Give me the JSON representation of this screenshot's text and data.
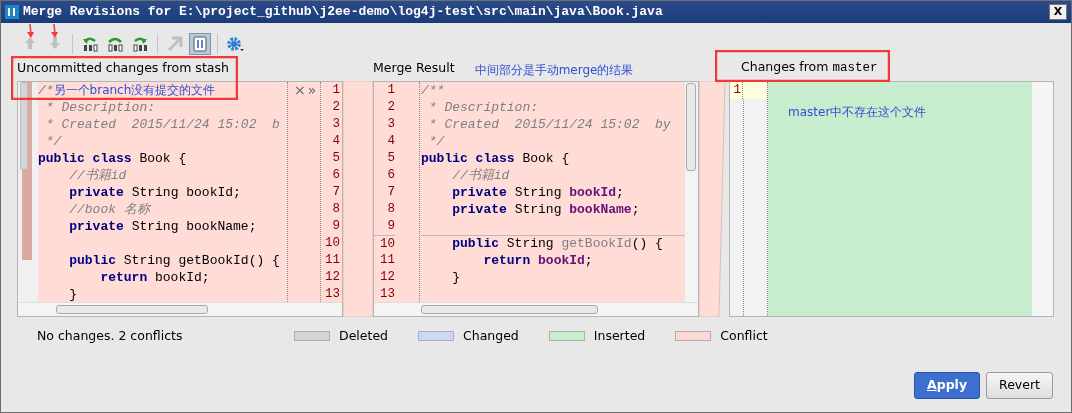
{
  "window": {
    "title": "Merge Revisions for E:\\project_github\\j2ee-demo\\log4j-test\\src\\main\\java\\Book.java",
    "close": "X"
  },
  "toolbar": [
    {
      "kind": "up",
      "disabled": true,
      "selected": false
    },
    {
      "kind": "down",
      "disabled": true,
      "selected": false
    },
    {
      "kind": "sep"
    },
    {
      "kind": "apply-left",
      "disabled": false,
      "selected": false
    },
    {
      "kind": "apply-both",
      "disabled": false,
      "selected": false
    },
    {
      "kind": "apply-right",
      "disabled": false,
      "selected": false
    },
    {
      "kind": "sep"
    },
    {
      "kind": "magic",
      "disabled": true,
      "selected": false
    },
    {
      "kind": "sync",
      "disabled": false,
      "selected": true
    },
    {
      "kind": "sep"
    },
    {
      "kind": "gear",
      "disabled": false,
      "selected": false
    }
  ],
  "left": {
    "header": "Uncommitted changes from stash",
    "actions": [
      "×",
      "»"
    ],
    "lines": [
      {
        "num": "1",
        "segs": [
          {
            "text": "/*",
            "kind": "comment"
          },
          {
            "text": "另一个branch没有提交的文件",
            "kind": "note"
          }
        ]
      },
      {
        "num": "2",
        "segs": [
          {
            "text": " * Description:",
            "kind": "comment"
          }
        ]
      },
      {
        "num": "3",
        "segs": [
          {
            "text": " * Created  2015/11/24 15:02  b",
            "kind": "comment"
          }
        ]
      },
      {
        "num": "4",
        "segs": [
          {
            "text": " */",
            "kind": "comment"
          }
        ]
      },
      {
        "num": "5",
        "segs": [
          {
            "text": "public class",
            "kind": "kw"
          },
          {
            "text": " Book {",
            "kind": "plain"
          }
        ]
      },
      {
        "num": "6",
        "segs": [
          {
            "text": "    //书籍id",
            "kind": "comment"
          }
        ]
      },
      {
        "num": "7",
        "segs": [
          {
            "text": "    private",
            "kind": "kw"
          },
          {
            "text": " String bookId;",
            "kind": "plain"
          }
        ]
      },
      {
        "num": "8",
        "segs": [
          {
            "text": "    //book 名称",
            "kind": "comment"
          }
        ]
      },
      {
        "num": "9",
        "segs": [
          {
            "text": "    private",
            "kind": "kw"
          },
          {
            "text": " String bookName;",
            "kind": "plain"
          }
        ]
      },
      {
        "num": "10"
      },
      {
        "num": "11",
        "segs": [
          {
            "text": "    public",
            "kind": "kw"
          },
          {
            "text": " String getBookId() {",
            "kind": "plain"
          }
        ]
      },
      {
        "num": "12",
        "segs": [
          {
            "text": "        return",
            "kind": "kw"
          },
          {
            "text": " bookId;",
            "kind": "plain"
          }
        ]
      },
      {
        "num": "13",
        "segs": [
          {
            "text": "    }",
            "kind": "plain"
          }
        ]
      }
    ]
  },
  "middle": {
    "header": "Merge Result",
    "note": "中间部分是手动merge的结果",
    "lines": [
      {
        "num": "1",
        "divider": false,
        "segs": [
          {
            "text": "/**",
            "kind": "comment"
          }
        ]
      },
      {
        "num": "2",
        "divider": false,
        "segs": [
          {
            "text": " * Description:",
            "kind": "comment"
          }
        ]
      },
      {
        "num": "3",
        "divider": false,
        "segs": [
          {
            "text": " * Created  2015/11/24 15:02  by",
            "kind": "comment"
          }
        ]
      },
      {
        "num": "4",
        "divider": false,
        "segs": [
          {
            "text": " */",
            "kind": "comment"
          }
        ]
      },
      {
        "num": "5",
        "divider": false,
        "segs": [
          {
            "text": "public class",
            "kind": "kw"
          },
          {
            "text": " Book {",
            "kind": "plain"
          }
        ]
      },
      {
        "num": "6",
        "divider": false,
        "segs": [
          {
            "text": "    //书籍id",
            "kind": "comment"
          }
        ]
      },
      {
        "num": "7",
        "divider": false,
        "segs": [
          {
            "text": "    private",
            "kind": "kw"
          },
          {
            "text": " String ",
            "kind": "plain"
          },
          {
            "text": "bookId",
            "kind": "field"
          },
          {
            "text": ";",
            "kind": "plain"
          }
        ]
      },
      {
        "num": "8",
        "divider": false,
        "segs": [
          {
            "text": "    private",
            "kind": "kw"
          },
          {
            "text": " String ",
            "kind": "plain"
          },
          {
            "text": "bookName",
            "kind": "field"
          },
          {
            "text": ";",
            "kind": "plain"
          }
        ]
      },
      {
        "num": "9",
        "divider": false
      },
      {
        "num": "10",
        "divider": true,
        "segs": [
          {
            "text": "    public",
            "kind": "kw"
          },
          {
            "text": " String ",
            "kind": "plain"
          },
          {
            "text": "getBookId",
            "kind": "dim"
          },
          {
            "text": "() {",
            "kind": "plain"
          }
        ]
      },
      {
        "num": "11",
        "divider": false,
        "segs": [
          {
            "text": "        return ",
            "kind": "kw"
          },
          {
            "text": "bookId",
            "kind": "field"
          },
          {
            "text": ";",
            "kind": "plain"
          }
        ]
      },
      {
        "num": "12",
        "divider": false,
        "segs": [
          {
            "text": "    }",
            "kind": "plain"
          }
        ]
      },
      {
        "num": "13",
        "divider": false
      }
    ]
  },
  "right": {
    "header": "Changes from ",
    "header_code": "master",
    "note": "master中不存在这个文件",
    "lines": [
      {
        "num": "1"
      }
    ]
  },
  "status": "No changes. 2 conflicts",
  "legend": [
    {
      "label": "Deleted",
      "color": "#d6d6d6"
    },
    {
      "label": "Changed",
      "color": "#cad9fa"
    },
    {
      "label": "Inserted",
      "color": "#c8eecb"
    },
    {
      "label": "Conflict",
      "color": "#ffd9d3"
    }
  ],
  "buttons": [
    {
      "label": "Apply",
      "kind": "primary"
    },
    {
      "label": "Revert",
      "kind": "secondary"
    }
  ]
}
